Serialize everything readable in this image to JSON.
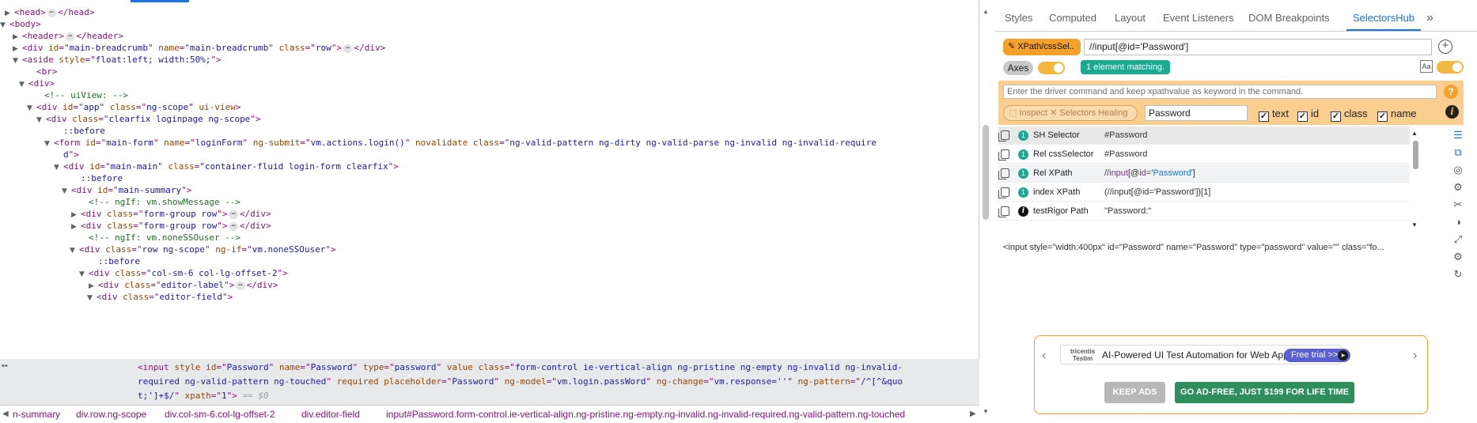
{
  "tree": [
    {
      "tri": "▶",
      "indent": 18,
      "parts": [
        [
          "tag",
          "<head>"
        ],
        [
          "ell",
          "⋯"
        ],
        [
          "tag",
          "</head>"
        ]
      ]
    },
    {
      "tri": "▼",
      "indent": 12,
      "parts": [
        [
          "tag",
          "<body>"
        ]
      ]
    },
    {
      "tri": "▶",
      "indent": 28,
      "parts": [
        [
          "tag",
          "<header>"
        ],
        [
          "ell",
          "⋯"
        ],
        [
          "tag",
          "</header>"
        ]
      ]
    },
    {
      "tri": "▶",
      "indent": 28,
      "parts": [
        [
          "tag",
          "<div "
        ],
        [
          "an",
          "id"
        ],
        [
          "tag",
          "=\""
        ],
        [
          "av",
          "main-breadcrumb"
        ],
        [
          "tag",
          "\" "
        ],
        [
          "an",
          "name"
        ],
        [
          "tag",
          "=\""
        ],
        [
          "av",
          "main-breadcrumb"
        ],
        [
          "tag",
          "\" "
        ],
        [
          "an",
          "class"
        ],
        [
          "tag",
          "=\""
        ],
        [
          "av",
          "row"
        ],
        [
          "tag",
          "\">"
        ],
        [
          "ell",
          "⋯"
        ],
        [
          "tag",
          "</div>"
        ]
      ]
    },
    {
      "tri": "▼",
      "indent": 28,
      "parts": [
        [
          "tag",
          "<aside "
        ],
        [
          "an",
          "style"
        ],
        [
          "tag",
          "=\""
        ],
        [
          "av",
          "float:left; width:50%;"
        ],
        [
          "tag",
          "\">"
        ]
      ]
    },
    {
      "tri": "",
      "indent": 46,
      "parts": [
        [
          "tag",
          "<br>"
        ]
      ]
    },
    {
      "tri": "▼",
      "indent": 36,
      "parts": [
        [
          "tag",
          "<div>"
        ]
      ]
    },
    {
      "tri": "",
      "indent": 56,
      "parts": [
        [
          "cm",
          "<!-- uiView: -->"
        ]
      ]
    },
    {
      "tri": "▼",
      "indent": 46,
      "parts": [
        [
          "tag",
          "<div "
        ],
        [
          "an",
          "id"
        ],
        [
          "tag",
          "=\""
        ],
        [
          "av",
          "app"
        ],
        [
          "tag",
          "\" "
        ],
        [
          "an",
          "class"
        ],
        [
          "tag",
          "=\""
        ],
        [
          "av",
          "ng-scope"
        ],
        [
          "tag",
          "\" "
        ],
        [
          "an",
          "ui-view"
        ],
        [
          "tag",
          ">"
        ]
      ]
    },
    {
      "tri": "▼",
      "indent": 58,
      "parts": [
        [
          "tag",
          "<div "
        ],
        [
          "an",
          "class"
        ],
        [
          "tag",
          "=\""
        ],
        [
          "av",
          "clearfix loginpage ng-scope"
        ],
        [
          "tag",
          "\">"
        ]
      ]
    },
    {
      "tri": "",
      "indent": 80,
      "parts": [
        [
          "ps",
          "::before"
        ]
      ]
    },
    {
      "tri": "▼",
      "indent": 68,
      "parts": [
        [
          "tag",
          "<form "
        ],
        [
          "an",
          "id"
        ],
        [
          "tag",
          "=\""
        ],
        [
          "av",
          "main-form"
        ],
        [
          "tag",
          "\" "
        ],
        [
          "an",
          "name"
        ],
        [
          "tag",
          "=\""
        ],
        [
          "av",
          "loginForm"
        ],
        [
          "tag",
          "\" "
        ],
        [
          "an",
          "ng-submit"
        ],
        [
          "tag",
          "=\""
        ],
        [
          "av",
          "vm.actions.login()"
        ],
        [
          "tag",
          "\" "
        ],
        [
          "an",
          "novalidate"
        ],
        [
          "tag",
          " "
        ],
        [
          "an",
          "class"
        ],
        [
          "tag",
          "=\""
        ],
        [
          "av",
          "ng-valid-pattern ng-dirty ng-valid-parse ng-invalid ng-invalid-require"
        ]
      ]
    },
    {
      "tri": "",
      "indent": 80,
      "parts": [
        [
          "av",
          "d"
        ],
        [
          "tag",
          "\">"
        ]
      ]
    },
    {
      "tri": "▼",
      "indent": 80,
      "parts": [
        [
          "tag",
          "<div "
        ],
        [
          "an",
          "id"
        ],
        [
          "tag",
          "=\""
        ],
        [
          "av",
          "main-main"
        ],
        [
          "tag",
          "\" "
        ],
        [
          "an",
          "class"
        ],
        [
          "tag",
          "=\""
        ],
        [
          "av",
          "container-fluid login-form clearfix"
        ],
        [
          "tag",
          "\">"
        ]
      ]
    },
    {
      "tri": "",
      "indent": 102,
      "parts": [
        [
          "ps",
          "::before"
        ]
      ]
    },
    {
      "tri": "▼",
      "indent": 90,
      "parts": [
        [
          "tag",
          "<div "
        ],
        [
          "an",
          "id"
        ],
        [
          "tag",
          "=\""
        ],
        [
          "av",
          "main-summary"
        ],
        [
          "tag",
          "\">"
        ]
      ]
    },
    {
      "tri": "",
      "indent": 112,
      "parts": [
        [
          "cm",
          "<!-- ngIf: vm.showMessage -->"
        ]
      ]
    },
    {
      "tri": "▶",
      "indent": 102,
      "parts": [
        [
          "tag",
          "<div "
        ],
        [
          "an",
          "class"
        ],
        [
          "tag",
          "=\""
        ],
        [
          "av",
          "form-group row"
        ],
        [
          "tag",
          "\">"
        ],
        [
          "ell",
          "⋯"
        ],
        [
          "tag",
          "</div>"
        ]
      ]
    },
    {
      "tri": "▶",
      "indent": 102,
      "parts": [
        [
          "tag",
          "<div "
        ],
        [
          "an",
          "class"
        ],
        [
          "tag",
          "=\""
        ],
        [
          "av",
          "form-group row"
        ],
        [
          "tag",
          "\">"
        ],
        [
          "ell",
          "⋯"
        ],
        [
          "tag",
          "</div>"
        ]
      ]
    },
    {
      "tri": "",
      "indent": 112,
      "parts": [
        [
          "cm",
          "<!-- ngIf: vm.noneSSOuser -->"
        ]
      ]
    },
    {
      "tri": "▼",
      "indent": 100,
      "parts": [
        [
          "tag",
          "<div "
        ],
        [
          "an",
          "class"
        ],
        [
          "tag",
          "=\""
        ],
        [
          "av",
          "row ng-scope"
        ],
        [
          "tag",
          "\" "
        ],
        [
          "an",
          "ng-if"
        ],
        [
          "tag",
          "=\""
        ],
        [
          "av",
          "vm.noneSSOuser"
        ],
        [
          "tag",
          "\">"
        ]
      ]
    },
    {
      "tri": "",
      "indent": 124,
      "parts": [
        [
          "ps",
          "::before"
        ]
      ]
    },
    {
      "tri": "▼",
      "indent": 112,
      "parts": [
        [
          "tag",
          "<div "
        ],
        [
          "an",
          "class"
        ],
        [
          "tag",
          "=\""
        ],
        [
          "av",
          "col-sm-6 col-lg-offset-2"
        ],
        [
          "tag",
          "\">"
        ]
      ]
    },
    {
      "tri": "▶",
      "indent": 124,
      "parts": [
        [
          "tag",
          "<div "
        ],
        [
          "an",
          "class"
        ],
        [
          "tag",
          "=\""
        ],
        [
          "av",
          "editor-label"
        ],
        [
          "tag",
          "\">"
        ],
        [
          "ell",
          "⋯"
        ],
        [
          "tag",
          "</div>"
        ]
      ]
    },
    {
      "tri": "▼",
      "indent": 122,
      "parts": [
        [
          "tag",
          "<div "
        ],
        [
          "an",
          "class"
        ],
        [
          "tag",
          "=\""
        ],
        [
          "av",
          "editor-field"
        ],
        [
          "tag",
          "\">"
        ]
      ]
    }
  ],
  "selected_node": {
    "dots": "••",
    "lines": [
      [
        [
          "tag",
          "<input "
        ],
        [
          "an",
          "style"
        ],
        [
          "tag",
          " "
        ],
        [
          "an",
          "id"
        ],
        [
          "tag",
          "=\""
        ],
        [
          "av",
          "Password"
        ],
        [
          "tag",
          "\" "
        ],
        [
          "an",
          "name"
        ],
        [
          "tag",
          "=\""
        ],
        [
          "av",
          "Password"
        ],
        [
          "tag",
          "\" "
        ],
        [
          "an",
          "type"
        ],
        [
          "tag",
          "=\""
        ],
        [
          "av",
          "password"
        ],
        [
          "tag",
          "\" "
        ],
        [
          "an",
          "value"
        ],
        [
          "tag",
          " "
        ],
        [
          "an",
          "class"
        ],
        [
          "tag",
          "=\""
        ],
        [
          "av",
          "form-control ie-vertical-align ng-pristine ng-empty ng-invalid ng-invalid-"
        ]
      ],
      [
        [
          "av",
          "required ng-valid-pattern ng-touched"
        ],
        [
          "tag",
          "\" "
        ],
        [
          "an",
          "required"
        ],
        [
          "tag",
          " "
        ],
        [
          "an",
          "placeholder"
        ],
        [
          "tag",
          "=\""
        ],
        [
          "av",
          "Password"
        ],
        [
          "tag",
          "\" "
        ],
        [
          "an",
          "ng-model"
        ],
        [
          "tag",
          "=\""
        ],
        [
          "av",
          "vm.login.passWord"
        ],
        [
          "tag",
          "\" "
        ],
        [
          "an",
          "ng-change"
        ],
        [
          "tag",
          "=\""
        ],
        [
          "av",
          "vm.response=''"
        ],
        [
          "tag",
          "\" "
        ],
        [
          "an",
          "ng-pattern"
        ],
        [
          "tag",
          "=\""
        ],
        [
          "av",
          "/^[^&quo"
        ]
      ],
      [
        [
          "av",
          "t;']+$/"
        ],
        [
          "tag",
          "\" "
        ],
        [
          "an",
          "xpath"
        ],
        [
          "tag",
          "=\""
        ],
        [
          "av",
          "1"
        ],
        [
          "tag",
          "\">"
        ],
        [
          "eq0",
          " == $0"
        ]
      ]
    ]
  },
  "breadcrumbs": {
    "left_arrow": "◀",
    "right_arrow": "▶",
    "items": [
      {
        "tag": "",
        "text": "n-summary"
      },
      {
        "tag": "div",
        "text": ".row.ng-scope"
      },
      {
        "tag": "div",
        "text": ".col-sm-6.col-lg-offset-2"
      },
      {
        "tag": "div",
        "text": ".editor-field"
      },
      {
        "tag": "input",
        "text": "#Password.form-control.ie-vertical-align.ng-pristine.ng-empty.ng-invalid.ng-invalid-required.ng-valid-pattern.ng-touched"
      }
    ]
  },
  "sidebar": {
    "tabs": [
      "Styles",
      "Computed",
      "Layout",
      "Event Listeners",
      "DOM Breakpoints",
      "SelectorsHub"
    ],
    "active_tab": "SelectorsHub",
    "more": "»"
  },
  "selectorshub": {
    "xpath_button": "XPath/cssSel..",
    "selector_value": "//input[@id='Password']",
    "add_icon": "+",
    "axes_label": "Axes",
    "match_text": "1 element matching.",
    "case_icon": "Aa",
    "driver_placeholder": "Enter the driver command and keep xpathvalue as keyword in the command.",
    "help_icon": "?",
    "inspect_label": "Inspect",
    "healing_label": "Selectors Healing",
    "attribute_value": "Password",
    "checkboxes": [
      {
        "label": "text",
        "check": "✓"
      },
      {
        "label": "id",
        "check": "✓"
      },
      {
        "label": "class",
        "check": "✓"
      },
      {
        "label": "name",
        "check": "✓"
      }
    ],
    "info_icon": "i",
    "results": [
      {
        "count": "1",
        "name": "SH Selector",
        "value": "#Password",
        "highlight": true
      },
      {
        "count": "1",
        "name": "Rel cssSelector",
        "value": "#Password",
        "highlight": false
      },
      {
        "count": "1",
        "name": "Rel XPath",
        "value_parts": [
          "//",
          "input",
          "[@",
          "id",
          "='",
          "Password",
          "']"
        ],
        "highlight": false
      },
      {
        "count": "1",
        "name": "index XPath",
        "value": "(//input[@id='Password'])[1]",
        "highlight": false
      },
      {
        "count": "i",
        "name": "testRigor Path",
        "value": "\"Password:\"",
        "highlight": false
      }
    ],
    "outer_html": "<input style=\"width:400px\" id=\"Password\" name=\"Password\" type=\"password\" value=\"\" class=\"fo...",
    "side_icons": [
      "☰",
      "⧉",
      "◎",
      "⚙",
      "✂",
      "◑",
      "⤢",
      "⚙",
      "↻"
    ]
  },
  "ad": {
    "logo_top": "tricentis",
    "logo_bottom": "Testim",
    "text": "AI-Powered UI Test Automation for Web Apps",
    "trial": "Free trial >>",
    "keep_ads": "KEEP ADS",
    "go_adfree": "GO AD-FREE, JUST $199 FOR LIFE TIME",
    "prev": "‹",
    "next": "›"
  }
}
